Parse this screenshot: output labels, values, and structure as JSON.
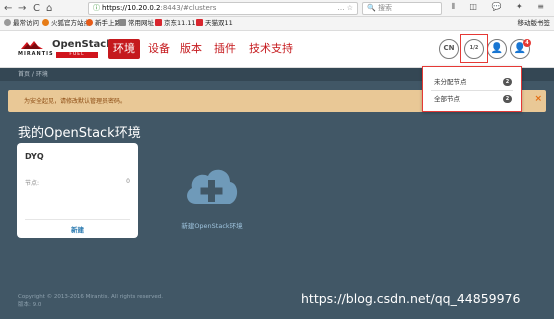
{
  "browser": {
    "back_icon": "←",
    "forward_icon": "→",
    "reload_icon": "C",
    "home_icon": "⌂",
    "url_info_icon": "ⓘ",
    "url_host": "https://10.20.0.2",
    "url_rest": ":8443/#clusters",
    "url_tail": "… ☆",
    "search_placeholder": "🔍 搜索",
    "toolbar_icons": "⫴ ◫ 💬 ✦ ≡",
    "mobile_bookmarks": "移动版书签"
  },
  "bookmarks": [
    {
      "label": "最常访问",
      "color": "#999999"
    },
    {
      "label": "火狐官方站点",
      "color": "#e67c17"
    },
    {
      "label": "新手上路",
      "color": "#e65a17"
    },
    {
      "label": "常用网址",
      "color": "#888888"
    },
    {
      "label": "京东11.11",
      "color": "#d8262e"
    },
    {
      "label": "天猫双11",
      "color": "#d8262e"
    }
  ],
  "header": {
    "logo_openstack": "OpenStack",
    "logo_fuel": "FUEL",
    "logo_mirantis": "MIRANTIS",
    "menu": [
      {
        "label": "环境",
        "active": true
      },
      {
        "label": "设备",
        "active": false
      },
      {
        "label": "版本",
        "active": false
      },
      {
        "label": "插件",
        "active": false
      },
      {
        "label": "技术支持",
        "active": false
      }
    ],
    "lang": "CN",
    "nodes_icon_text": "1/2",
    "user_icon": "👤",
    "notif_icon": "👤",
    "notif_count": "4"
  },
  "breadcrumb": "首页 / 环境",
  "warning": {
    "message": "为安全起见，请修改默认管理员密码。",
    "close": "×"
  },
  "nodes_dropdown": {
    "items": [
      {
        "label": "未分配节点",
        "count": "2"
      },
      {
        "label": "全部节点",
        "count": "2"
      }
    ]
  },
  "page": {
    "title": "我的OpenStack环境"
  },
  "cluster_card": {
    "name": "DYQ",
    "nodes_label": "节点:",
    "nodes_value": "0",
    "create": "新建"
  },
  "new_env": {
    "label": "新建OpenStack环境",
    "plus": "+"
  },
  "footer": {
    "copyright": "Copyright © 2013-2016 Mirantis. All rights reserved.",
    "version": "版本: 9.0"
  },
  "watermark": "https://blog.csdn.net/qq_44859976",
  "colors": {
    "brand_red": "#c5191d",
    "page_bg": "#415766",
    "highlight_red": "#e53935"
  }
}
